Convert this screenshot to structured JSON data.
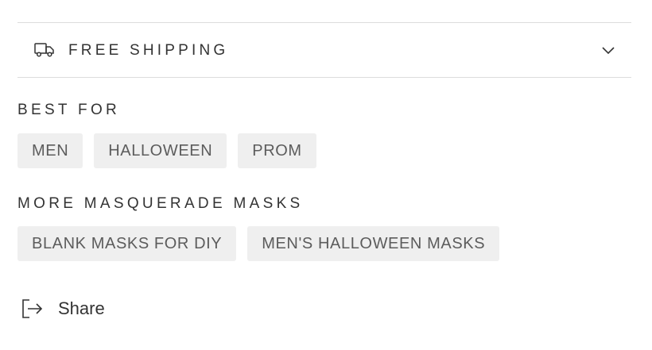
{
  "accordion": {
    "title": "FREE SHIPPING",
    "icon": "truck-icon",
    "toggle_icon": "chevron-down-icon"
  },
  "best_for": {
    "heading": "BEST FOR",
    "tags": [
      "MEN",
      "HALLOWEEN",
      "PROM"
    ]
  },
  "more": {
    "heading": "MORE MASQUERADE MASKS",
    "tags": [
      "BLANK MASKS FOR DIY",
      "MEN'S HALLOWEEN MASKS"
    ]
  },
  "share": {
    "label": "Share",
    "icon": "share-icon"
  },
  "colors": {
    "tag_bg": "#efefef",
    "tag_text": "#5c5c5c",
    "divider": "#dcdcdc",
    "text": "#333333"
  }
}
